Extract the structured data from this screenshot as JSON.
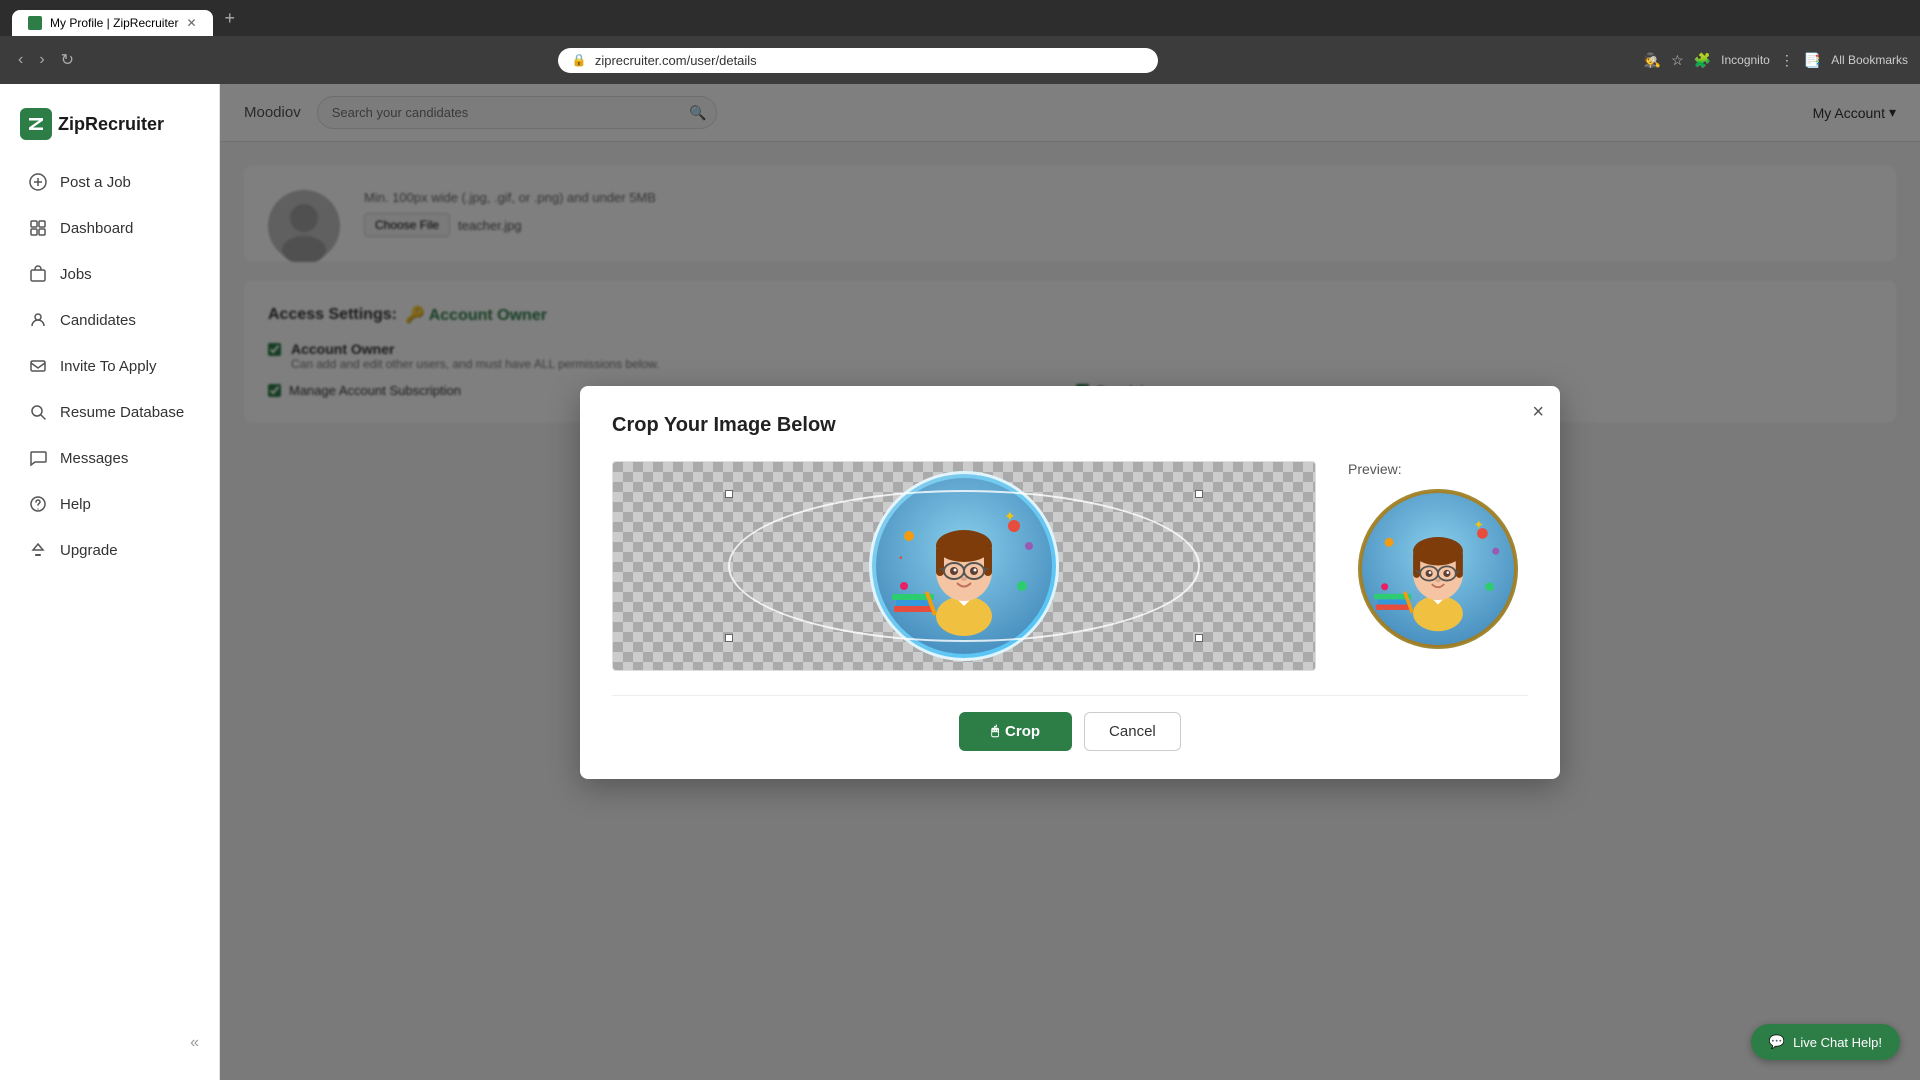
{
  "browser": {
    "url": "ziprecruiter.com/user/details",
    "tab_title": "My Profile | ZipRecruiter",
    "favicon": "Z"
  },
  "topbar": {
    "company_name": "Moodiov",
    "search_placeholder": "Search your candidates",
    "my_account_label": "My Account"
  },
  "sidebar": {
    "logo_text": "ZipRecruiter",
    "items": [
      {
        "id": "post-a-job",
        "label": "Post a Job",
        "icon": "➕"
      },
      {
        "id": "dashboard",
        "label": "Dashboard",
        "icon": "⊞"
      },
      {
        "id": "jobs",
        "label": "Jobs",
        "icon": "💼"
      },
      {
        "id": "candidates",
        "label": "Candidates",
        "icon": "👤"
      },
      {
        "id": "invite-to-apply",
        "label": "Invite To Apply",
        "icon": "✉"
      },
      {
        "id": "resume-database",
        "label": "Resume Database",
        "icon": "🔍"
      },
      {
        "id": "messages",
        "label": "Messages",
        "icon": "💬"
      },
      {
        "id": "help",
        "label": "Help",
        "icon": "❓"
      },
      {
        "id": "upgrade",
        "label": "Upgrade",
        "icon": "⬆"
      }
    ]
  },
  "dialog": {
    "title": "Crop Your Image Below",
    "close_label": "×",
    "preview_label": "Preview:",
    "crop_button": "Crop",
    "cancel_button": "Cancel"
  },
  "profile_section": {
    "file_info": "Min. 100px wide (.jpg, .gif, or .png) and under 5MB",
    "choose_file_label": "Choose File",
    "file_name": "teacher.jpg"
  },
  "access_settings": {
    "title": "Access Settings:",
    "owner_icon": "🔑",
    "owner_label": "Account Owner",
    "account_owner": {
      "label": "Account Owner",
      "description": "Can add and edit other users, and must have ALL permissions below."
    },
    "bottom_items": [
      {
        "label": "Manage Account Subscription",
        "checked": true
      },
      {
        "label": "Post Jobs",
        "checked": true
      }
    ]
  },
  "live_chat": {
    "label": "Live Chat Help!"
  }
}
